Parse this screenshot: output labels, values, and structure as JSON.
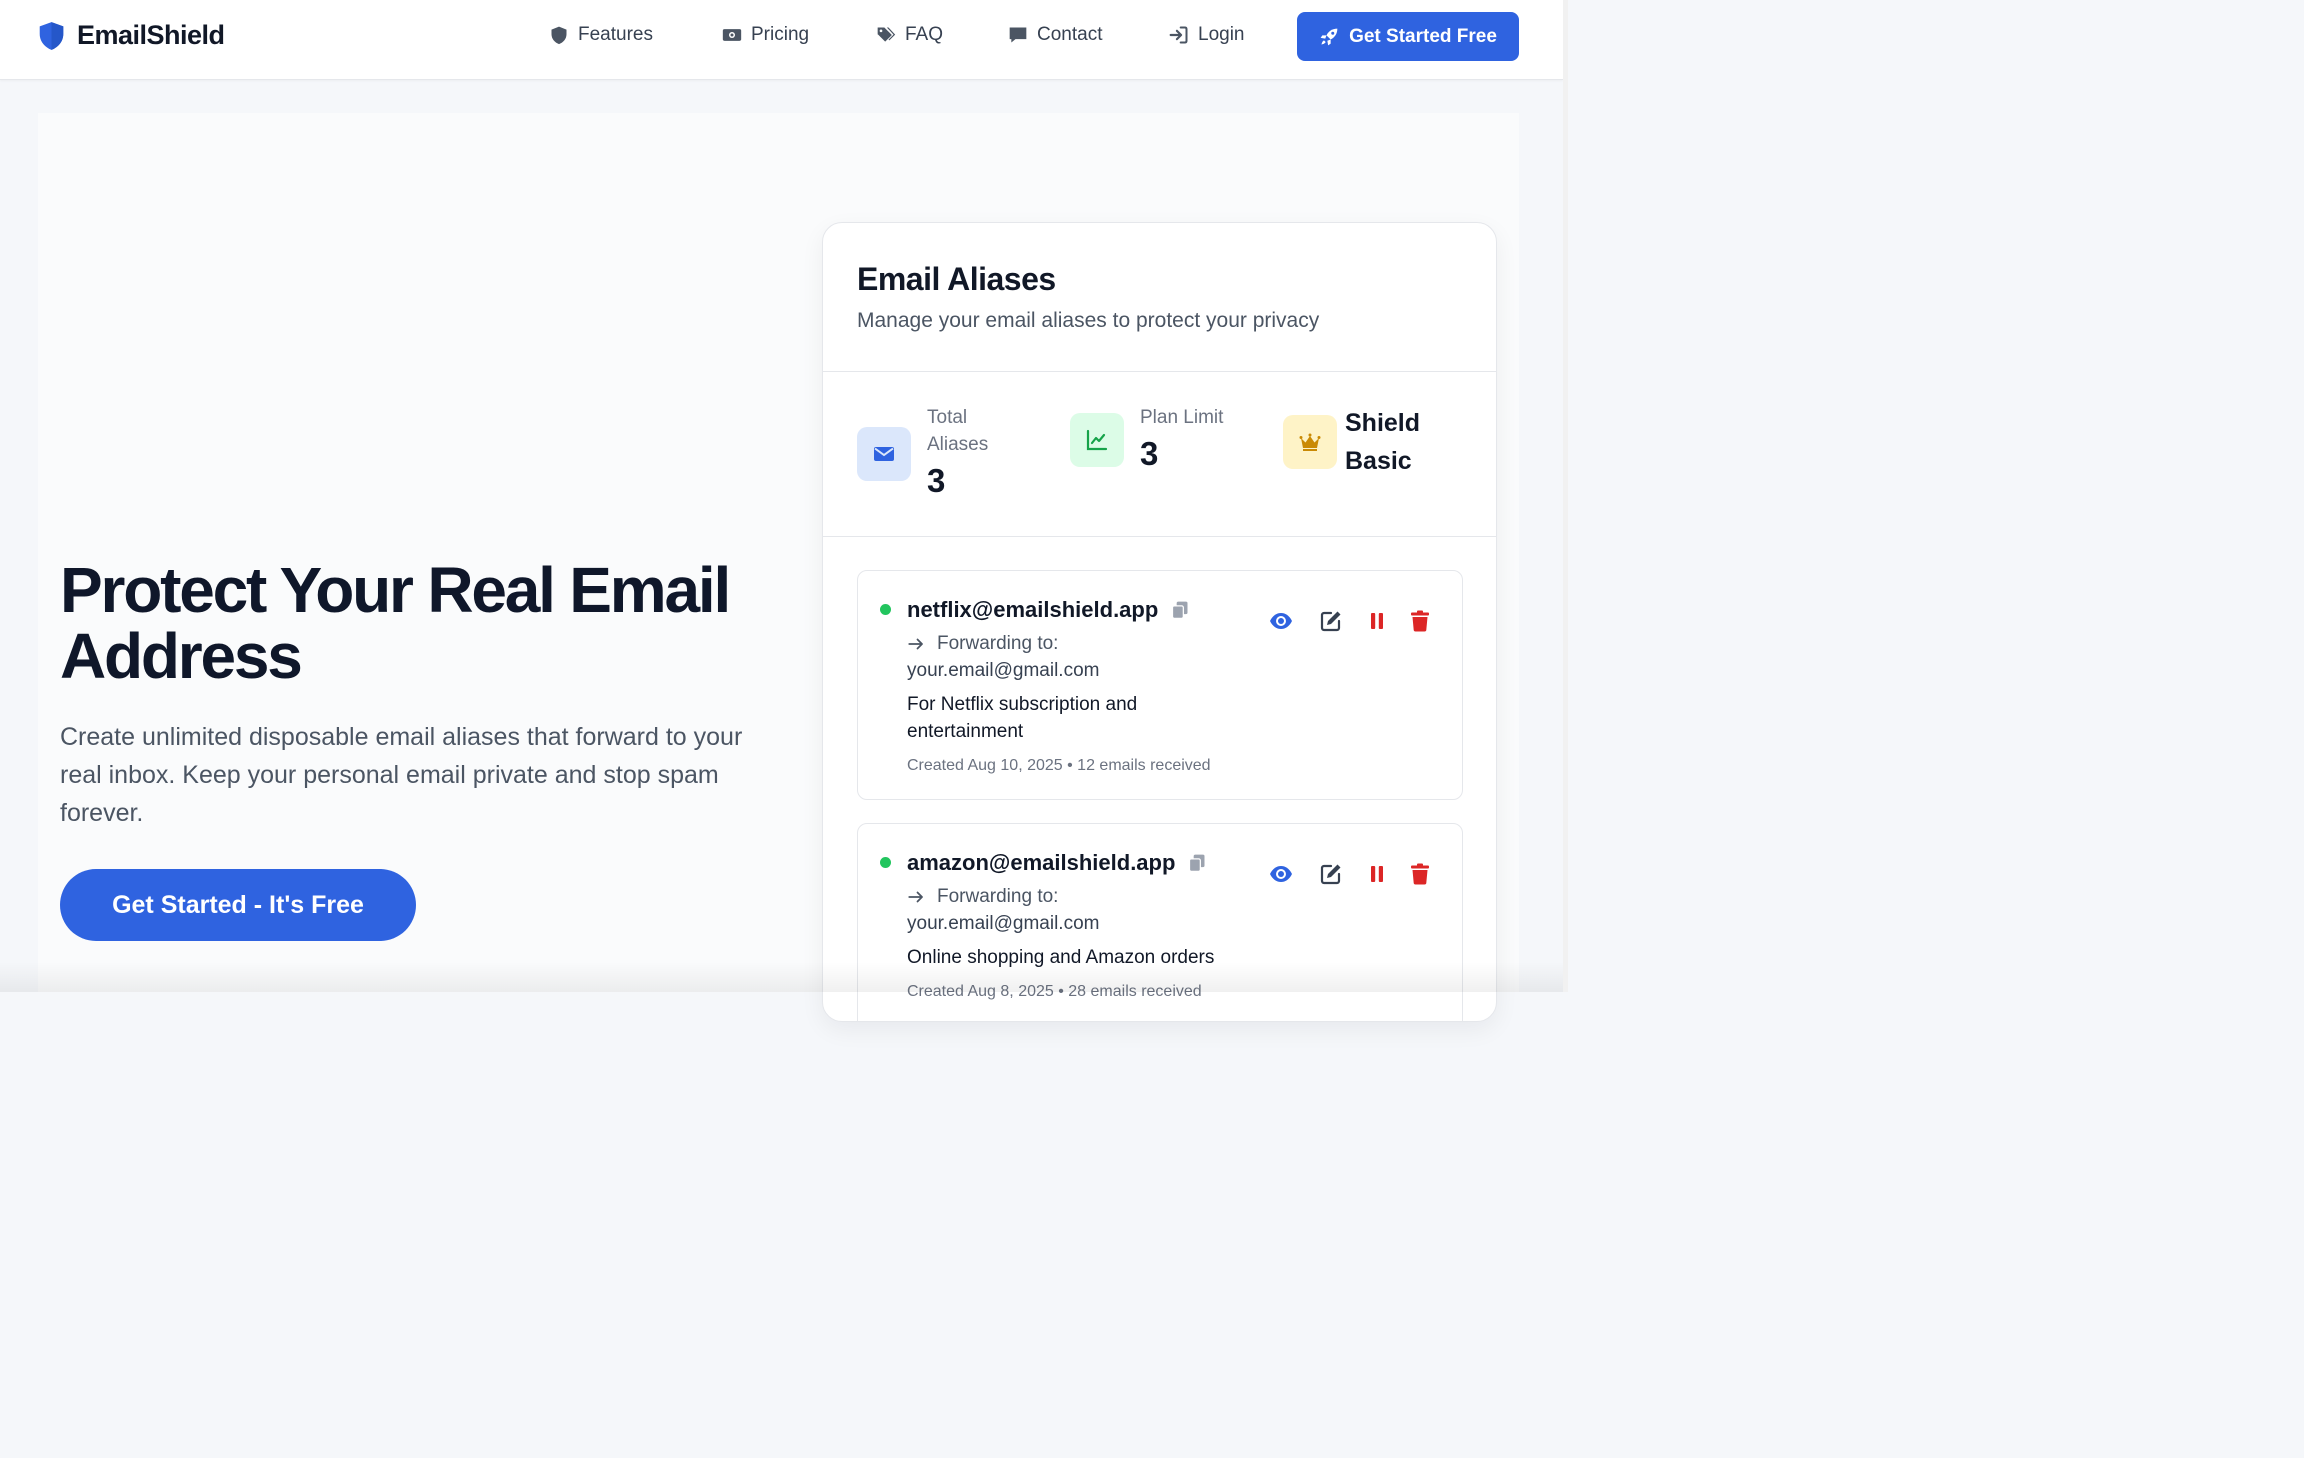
{
  "brand": {
    "name": "EmailShield",
    "icon": "shield-icon"
  },
  "nav": {
    "links": [
      {
        "label": "Features",
        "icon": "shield-icon"
      },
      {
        "label": "Pricing",
        "icon": "money-bill-icon"
      },
      {
        "label": "FAQ",
        "icon": "tags-icon"
      },
      {
        "label": "Contact",
        "icon": "comment-icon"
      },
      {
        "label": "Login",
        "icon": "sign-in-icon"
      }
    ],
    "cta": {
      "label": "Get Started Free",
      "icon": "rocket-icon"
    }
  },
  "hero": {
    "title": "Protect Your Real Email Address",
    "subtitle": "Create unlimited disposable email aliases that forward to your real inbox. Keep your personal email private and stop spam forever.",
    "cta": "Get Started - It's Free"
  },
  "card": {
    "title": "Email Aliases",
    "subtitle": "Manage your email aliases to protect your privacy",
    "stats": [
      {
        "label": "Total Aliases",
        "value": "3",
        "icon": "envelope-icon"
      },
      {
        "label": "Plan Limit",
        "value": "3",
        "icon": "chart-line-icon"
      },
      {
        "label": "",
        "value": "Shield Basic",
        "icon": "crown-icon"
      }
    ],
    "forwarding_label": "Forwarding to:",
    "aliases": [
      {
        "address": "netflix@emailshield.app",
        "forward_to": "your.email@gmail.com",
        "description": "For Netflix subscription and entertainment",
        "meta": "Created Aug 10, 2025 • 12 emails received",
        "status": "active"
      },
      {
        "address": "amazon@emailshield.app",
        "forward_to": "your.email@gmail.com",
        "description": "Online shopping and Amazon orders",
        "meta": "Created Aug 8, 2025 • 28 emails received",
        "status": "active"
      }
    ]
  },
  "colors": {
    "primary": "#2f63e0",
    "danger": "#dc2626",
    "success": "#22c55e",
    "text": "#111827",
    "muted": "#6b7280"
  }
}
